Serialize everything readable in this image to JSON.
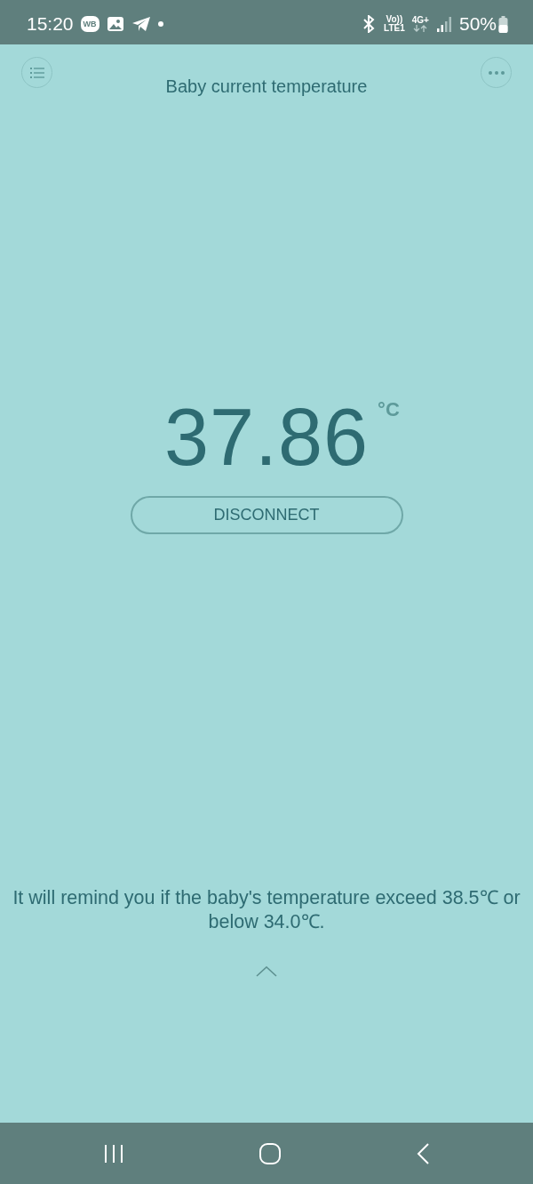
{
  "status_bar": {
    "time": "15:20",
    "badge": "WB",
    "volte": "Vo))",
    "lte": "LTE1",
    "network": "4G+",
    "battery": "50%"
  },
  "header": {
    "title": "Baby current temperature"
  },
  "reading": {
    "value": "37.86",
    "unit": "°C"
  },
  "disconnect_button": {
    "label": "DISCONNECT"
  },
  "reminder": "It will remind you if the baby's temperature exceed 38.5℃ or below 34.0℃."
}
